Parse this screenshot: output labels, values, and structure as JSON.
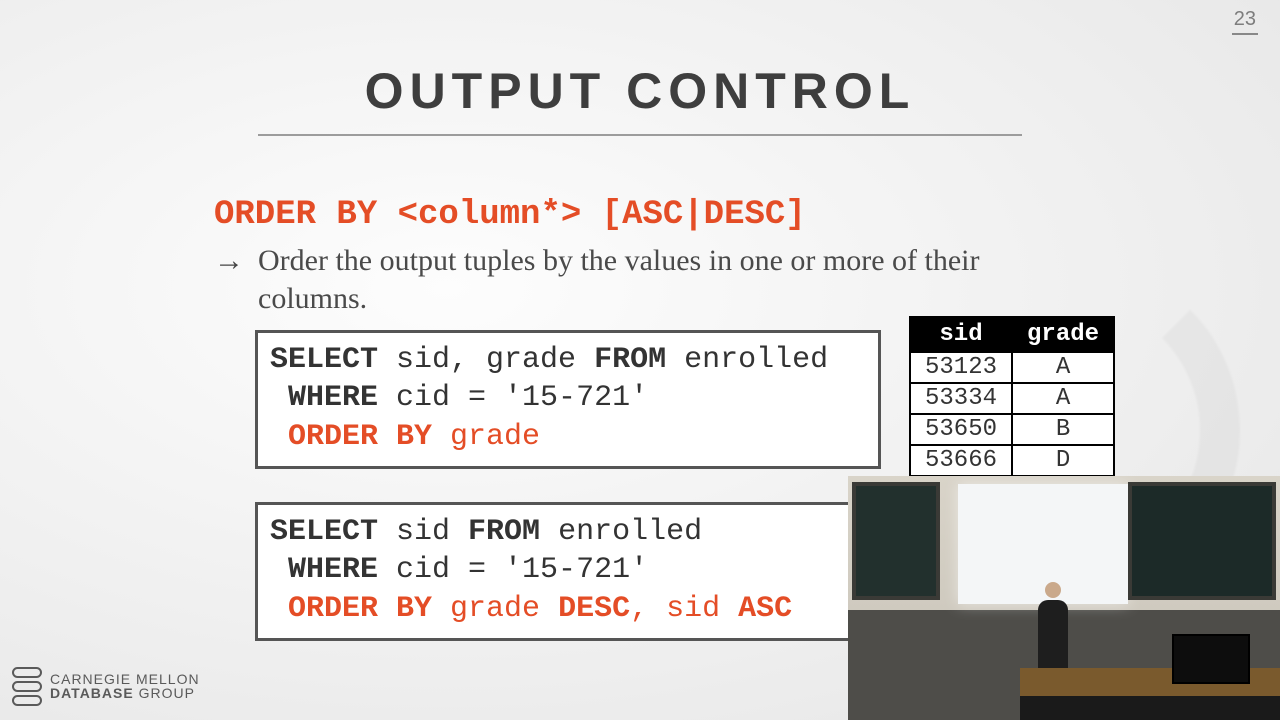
{
  "page_number": "23",
  "title": "OUTPUT CONTROL",
  "syntax": "ORDER BY <column*> [ASC|DESC]",
  "description": "Order the output tuples by the values in one or more of their columns.",
  "code1": {
    "l1a": "SELECT",
    "l1b": " sid, grade ",
    "l1c": "FROM",
    "l1d": " enrolled",
    "l2a": " WHERE",
    "l2b": " cid = '15-721'",
    "l3a": " ORDER BY ",
    "l3b": "grade"
  },
  "code2": {
    "l1a": "SELECT",
    "l1b": " sid ",
    "l1c": "FROM",
    "l1d": " enrolled",
    "l2a": " WHERE",
    "l2b": " cid = '15-721'",
    "l3a": " ORDER BY ",
    "l3b": "grade ",
    "l3c": "DESC",
    "l3d": ", sid ",
    "l3e": "ASC"
  },
  "result": {
    "headers": [
      "sid",
      "grade"
    ],
    "rows": [
      [
        "53123",
        "A"
      ],
      [
        "53334",
        "A"
      ],
      [
        "53650",
        "B"
      ],
      [
        "53666",
        "D"
      ]
    ]
  },
  "footer": {
    "line1": "CARNEGIE MELLON",
    "line2a": "DATABASE",
    "line2b": " GROUP"
  },
  "chart_data": {
    "type": "table",
    "title": "Result of ORDER BY grade on enrolled WHERE cid='15-721'",
    "columns": [
      "sid",
      "grade"
    ],
    "rows": [
      {
        "sid": 53123,
        "grade": "A"
      },
      {
        "sid": 53334,
        "grade": "A"
      },
      {
        "sid": 53650,
        "grade": "B"
      },
      {
        "sid": 53666,
        "grade": "D"
      }
    ]
  }
}
